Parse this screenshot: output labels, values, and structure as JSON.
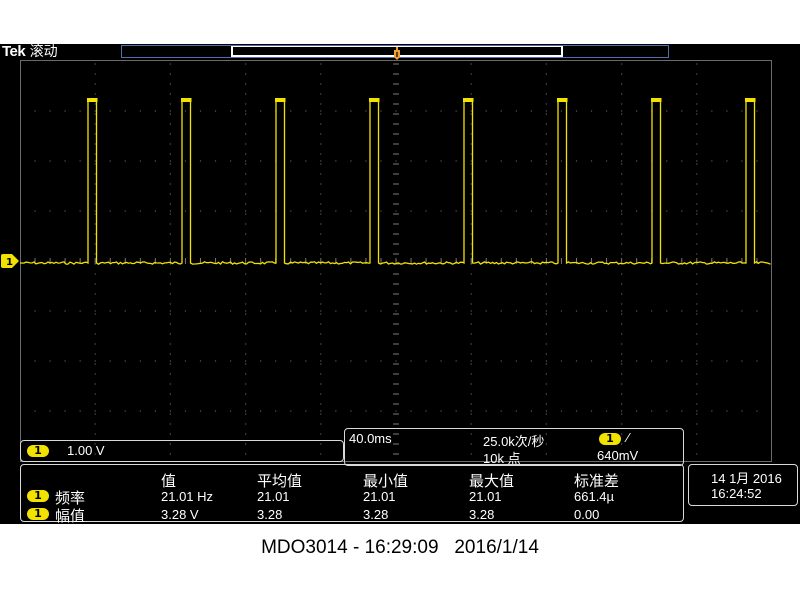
{
  "header": {
    "brand": "Tek",
    "mode": "滚动"
  },
  "channel": {
    "number": "1",
    "scale": "1.00 V",
    "color": "#f2e200"
  },
  "waveform": {
    "periods": 8,
    "width_fraction": 0.09
  },
  "acquisition": {
    "timebase": "40.0ms",
    "sample_rate": "25.0k次/秒",
    "record_length": "10k 点",
    "trigger_channel": "1",
    "trigger_slope": "∕",
    "trigger_level": "640mV"
  },
  "measurements": {
    "headers": [
      "值",
      "平均值",
      "最小值",
      "最大值",
      "标准差"
    ],
    "rows": [
      {
        "channel": "1",
        "label": "频率",
        "cells": [
          "21.01 Hz",
          "21.01",
          "21.01",
          "21.01",
          "661.4µ"
        ]
      },
      {
        "channel": "1",
        "label": "幅值",
        "cells": [
          "3.28 V",
          "3.28",
          "3.28",
          "3.28",
          "0.00"
        ]
      }
    ]
  },
  "datetime": {
    "date": "14 1月 2016",
    "time": "16:24:52"
  },
  "caption": "MDO3014 - 16:29:09   2016/1/14",
  "colors": {
    "trace": "#f2e200",
    "trigger_marker": "#f0a030",
    "grid_dots": "#5a5a5a",
    "frame": "#4f6fae"
  }
}
